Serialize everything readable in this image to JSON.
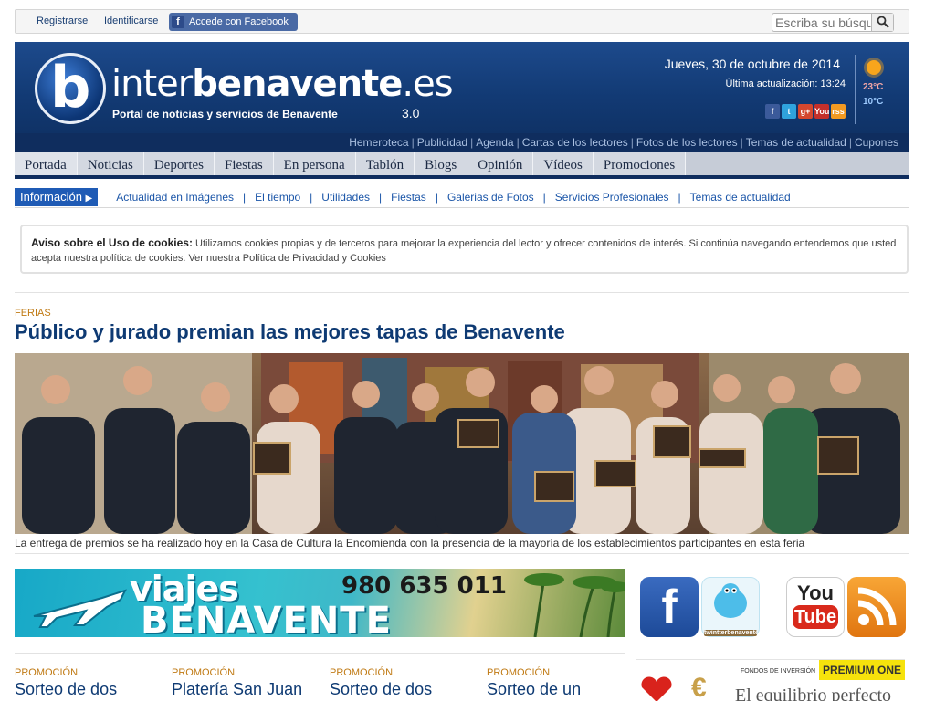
{
  "topbar": {
    "register": "Registrarse",
    "login": "Identificarse",
    "facebook": "Accede con Facebook",
    "facebook_icon": "f",
    "search_placeholder": "Escriba su búsqueda"
  },
  "header": {
    "logo_prefix": "inter",
    "logo_bold": "benavente",
    "logo_suffix": ".es",
    "tagline": "Portal de noticias y servicios de Benavente",
    "version": "3.0",
    "date": "Jueves, 30 de octubre de 2014",
    "updated": "Última actualización: 13:24",
    "weather": {
      "high": "23°C",
      "low": "10°C",
      "icon": "sun-icon"
    },
    "social_mini": [
      "facebook",
      "twitter",
      "google-plus",
      "youtube",
      "rss"
    ],
    "social_mini_labels": [
      "f",
      "t",
      "g+",
      "You",
      "rss"
    ],
    "social_mini_colors": [
      "#3b5a9a",
      "#2fa3dd",
      "#d4472e",
      "#c4302b",
      "#f39a21"
    ]
  },
  "sublinks": [
    "Hemeroteca",
    "Publicidad",
    "Agenda",
    "Cartas de los lectores",
    "Fotos de los lectores",
    "Temas de actualidad",
    "Cupones"
  ],
  "mainnav": [
    "Portada",
    "Noticias",
    "Deportes",
    "Fiestas",
    "En persona",
    "Tablón",
    "Blogs",
    "Opinión",
    "Vídeos",
    "Promociones"
  ],
  "infonav": {
    "label": "Información",
    "items": [
      "Actualidad en Imágenes",
      "El tiempo",
      "Utilidades",
      "Fiestas",
      "Galerias de Fotos",
      "Servicios Profesionales",
      "Temas de actualidad"
    ]
  },
  "cookie": {
    "title": "Aviso sobre el Uso de cookies:",
    "text": "Utilizamos cookies propias y de terceros para mejorar la experiencia del lector y ofrecer contenidos de interés. Si continúa navegando entendemos que usted acepta nuestra política de cookies. Ver nuestra Política de Privacidad y Cookies"
  },
  "main_story": {
    "kicker": "FERIAS",
    "title": "Público y jurado premian las mejores tapas de Benavente",
    "caption": "La entrega de premios se ha realizado hoy en la Casa de Cultura la Encomienda con la presencia de la mayoría de los establecimientos participantes en esta feria"
  },
  "banner": {
    "line1": "viajes",
    "line2": "BENAVENTE",
    "phone": "980 635 011"
  },
  "social_big": [
    {
      "label": "f",
      "color": "#2c5aa8"
    },
    {
      "label": "twintterbenavente",
      "color": "#4dbde9"
    },
    {
      "label": "You Tube",
      "color": "#d92a1c"
    },
    {
      "label": "rss",
      "color": "#f08c1a"
    }
  ],
  "promos": [
    {
      "kicker": "PROMOCIÓN",
      "title": "Sorteo de dos"
    },
    {
      "kicker": "PROMOCIÓN",
      "title": "Platería San Juan"
    },
    {
      "kicker": "PROMOCIÓN",
      "title": "Sorteo de dos"
    },
    {
      "kicker": "PROMOCIÓN",
      "title": "Sorteo de un"
    }
  ],
  "ad_fund": {
    "small": "FONDOS DE INVERSIÓN",
    "brand": "PREMIUM ONE",
    "tagline": "El equilibrio perfecto"
  }
}
